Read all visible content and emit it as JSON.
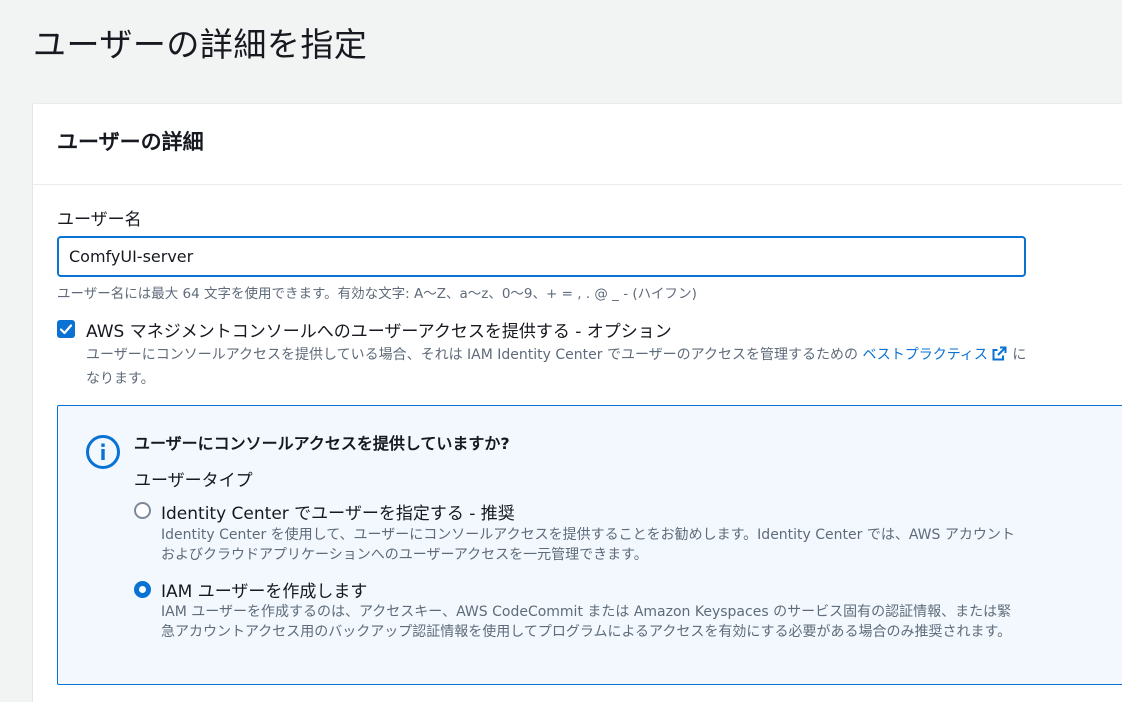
{
  "page": {
    "title": "ユーザーの詳細を指定"
  },
  "panel": {
    "title": "ユーザーの詳細"
  },
  "username": {
    "label": "ユーザー名",
    "value": "ComfyUI-server",
    "constraint": "ユーザー名には最大 64 文字を使用できます。有効な文字: A～Z、a～z、0～9、+ = , . @ _ - (ハイフン)"
  },
  "console_access": {
    "checked": true,
    "label": "AWS マネジメントコンソールへのユーザーアクセスを提供する - オプション",
    "desc_prefix": "ユーザーにコンソールアクセスを提供している場合、それは IAM Identity Center でユーザーのアクセスを管理するための ",
    "link_text": "ベストプラクティス",
    "desc_suffix": " になります。"
  },
  "info": {
    "heading": "ユーザーにコンソールアクセスを提供していますか?",
    "user_type_label": "ユーザータイプ",
    "options": [
      {
        "label": "Identity Center でユーザーを指定する - 推奨",
        "desc": "Identity Center を使用して、ユーザーにコンソールアクセスを提供することをお勧めします。Identity Center では、AWS アカウントおよびクラウドアプリケーションへのユーザーアクセスを一元管理できます。",
        "selected": false
      },
      {
        "label": "IAM ユーザーを作成します",
        "desc": "IAM ユーザーを作成するのは、アクセスキー、AWS CodeCommit または Amazon Keyspaces のサービス固有の認証情報、または緊急アカウントアクセス用のバックアップ認証情報を使用してプログラムによるアクセスを有効にする必要がある場合のみ推奨されます。",
        "selected": true
      }
    ]
  },
  "colors": {
    "accent": "#0972d3",
    "info_bg": "#f2f8fd",
    "muted_text": "#5f6b7a"
  }
}
